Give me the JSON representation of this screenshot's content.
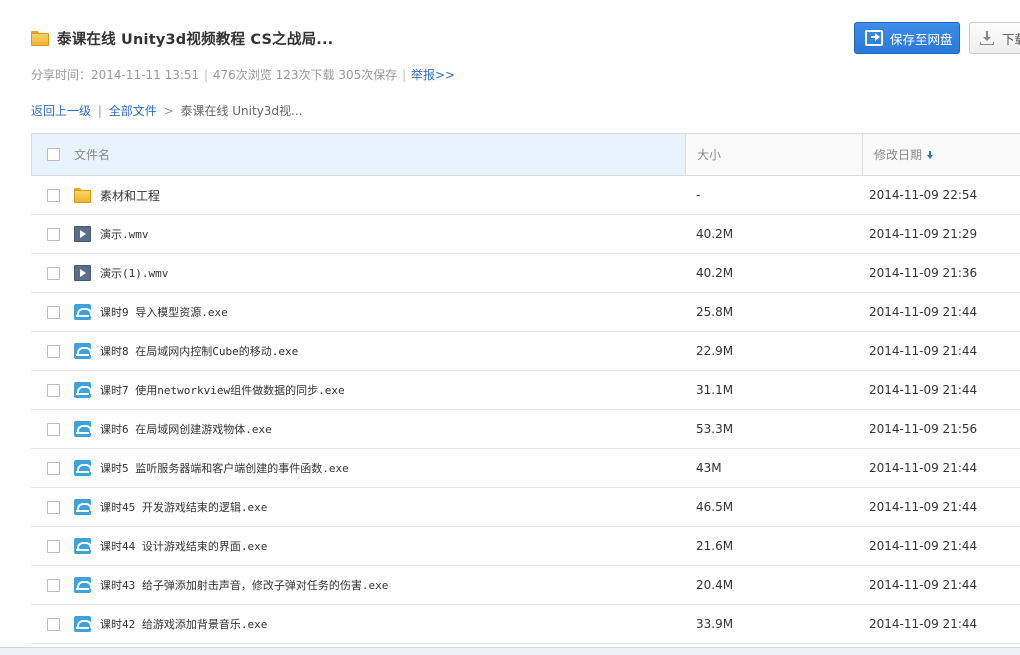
{
  "header": {
    "title": "泰课在线 Unity3d视频教程 CS之战局...",
    "save_button": "保存至网盘",
    "download_button": "下载"
  },
  "meta": {
    "share_label": "分享时间：",
    "share_time": "2014-11-11 13:51",
    "views": "476次浏览",
    "downloads": "123次下载",
    "saves": "305次保存",
    "report": "举报>>"
  },
  "breadcrumb": {
    "back": "返回上一级",
    "all_files": "全部文件",
    "current": "泰课在线 Unity3d视..."
  },
  "table": {
    "columns": {
      "name": "文件名",
      "size": "大小",
      "date": "修改日期"
    },
    "rows": [
      {
        "name": "素材和工程",
        "size": "-",
        "date": "2014-11-09 22:54",
        "type": "folder-icon"
      },
      {
        "name": "演示.wmv",
        "size": "40.2M",
        "date": "2014-11-09 21:29",
        "type": "video-file-icon"
      },
      {
        "name": "演示(1).wmv",
        "size": "40.2M",
        "date": "2014-11-09 21:36",
        "type": "video-file-icon"
      },
      {
        "name": "课时9 导入模型资源.exe",
        "size": "25.8M",
        "date": "2014-11-09 21:44",
        "type": "exe-file-icon"
      },
      {
        "name": "课时8 在局域网内控制Cube的移动.exe",
        "size": "22.9M",
        "date": "2014-11-09 21:44",
        "type": "exe-file-icon"
      },
      {
        "name": "课时7 使用networkview组件做数据的同步.exe",
        "size": "31.1M",
        "date": "2014-11-09 21:44",
        "type": "exe-file-icon"
      },
      {
        "name": "课时6 在局域网创建游戏物体.exe",
        "size": "53.3M",
        "date": "2014-11-09 21:56",
        "type": "exe-file-icon"
      },
      {
        "name": "课时5 监听服务器端和客户端创建的事件函数.exe",
        "size": "43M",
        "date": "2014-11-09 21:44",
        "type": "exe-file-icon"
      },
      {
        "name": "课时45 开发游戏结束的逻辑.exe",
        "size": "46.5M",
        "date": "2014-11-09 21:44",
        "type": "exe-file-icon"
      },
      {
        "name": "课时44 设计游戏结束的界面.exe",
        "size": "21.6M",
        "date": "2014-11-09 21:44",
        "type": "exe-file-icon"
      },
      {
        "name": "课时43 给子弹添加射击声音，修改子弹对任务的伤害.exe",
        "size": "20.4M",
        "date": "2014-11-09 21:44",
        "type": "exe-file-icon"
      },
      {
        "name": "课时42 给游戏添加背景音乐.exe",
        "size": "33.9M",
        "date": "2014-11-09 21:44",
        "type": "exe-file-icon"
      }
    ]
  },
  "colors": {
    "accent": "#2f6fc5",
    "save_button": "#2a78d6",
    "header_highlight": "#e9f3fd"
  }
}
